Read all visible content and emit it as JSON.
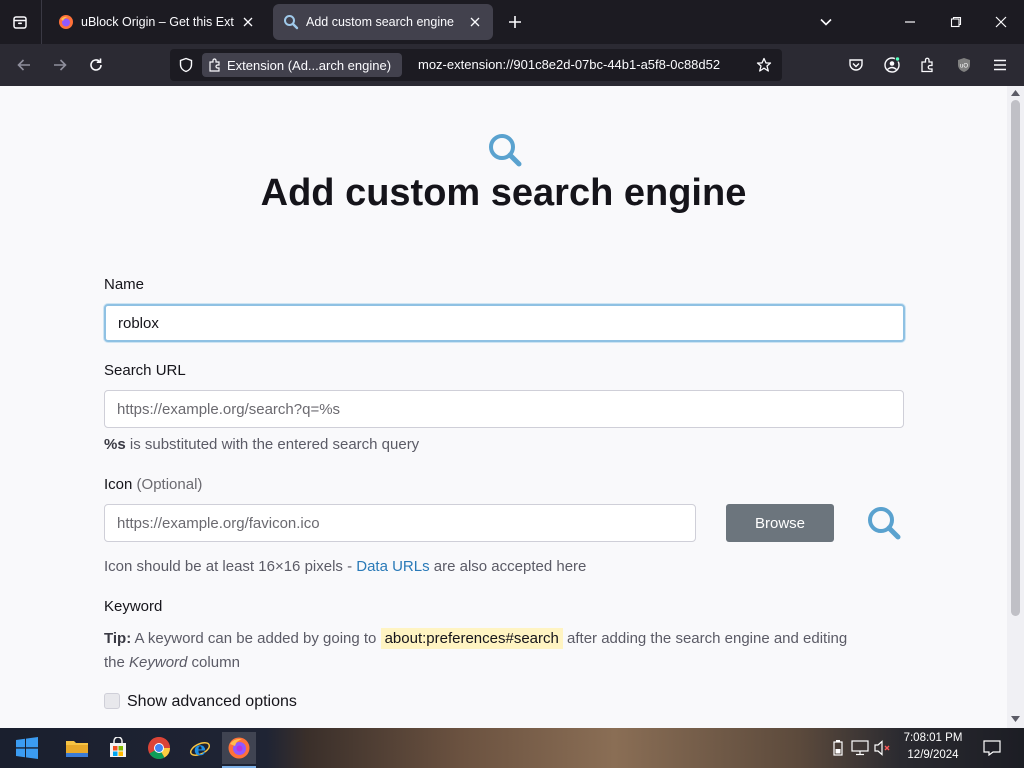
{
  "browser": {
    "tabs": [
      {
        "title": "uBlock Origin – Get this Extension",
        "active": false
      },
      {
        "title": "Add custom search engine",
        "active": true
      }
    ],
    "identity_label": "Extension (Ad...arch engine)",
    "url": "moz-extension://901c8e2d-07bc-44b1-a5f8-0c88d52",
    "accent_color": "#42414d"
  },
  "page": {
    "title": "Add custom search engine",
    "name": {
      "label": "Name",
      "value": "roblox"
    },
    "search_url": {
      "label": "Search URL",
      "placeholder": "https://example.org/search?q=%s",
      "hint_token": "%s",
      "hint_rest": " is substituted with the entered search query"
    },
    "icon": {
      "label": "Icon",
      "optional": "(Optional)",
      "placeholder": "https://example.org/favicon.ico",
      "browse_label": "Browse",
      "hint_before": "Icon should be at least 16×16 pixels - ",
      "hint_link": "Data URLs",
      "hint_after": " are also accepted here"
    },
    "keyword": {
      "label": "Keyword",
      "tip_label": "Tip:",
      "tip_before": " A keyword can be added by going to ",
      "tip_code": "about:preferences#search",
      "tip_after": " after adding the search engine and editing",
      "tip_line2_before": "the ",
      "tip_line2_em": "Keyword",
      "tip_line2_after": " column"
    },
    "advanced": {
      "label": "Show advanced options",
      "checked": false
    },
    "accent_color": "#5aa2cf"
  },
  "taskbar": {
    "time": "7:08:01 PM",
    "date": "12/9/2024",
    "apps": [
      "start",
      "file-explorer",
      "store",
      "chrome",
      "internet-explorer",
      "firefox"
    ],
    "active_app": "firefox"
  }
}
